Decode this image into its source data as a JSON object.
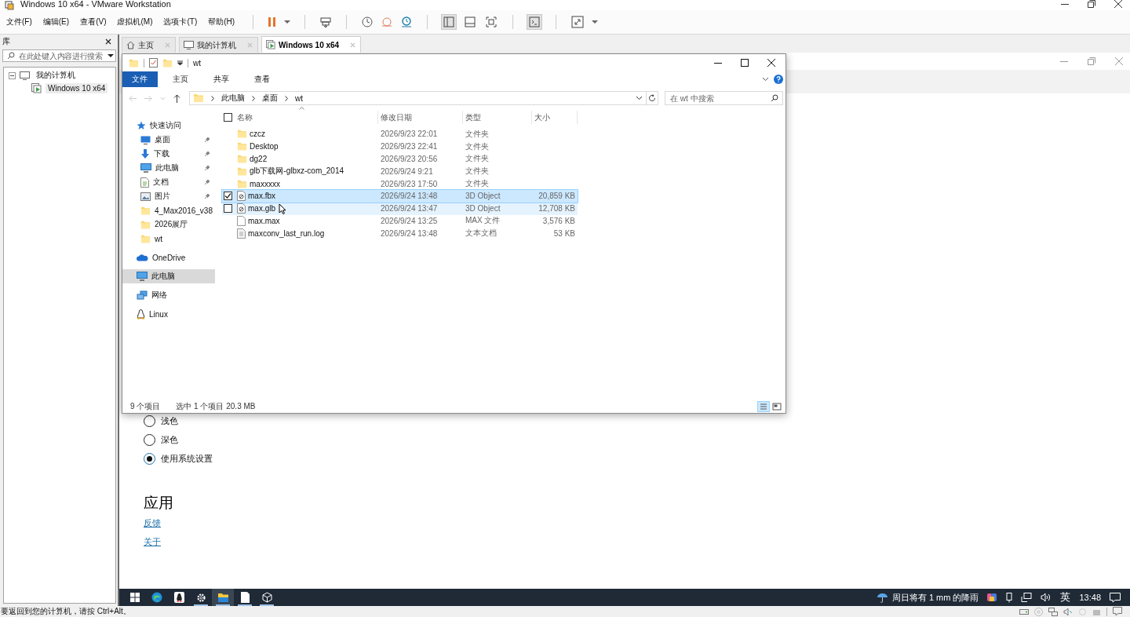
{
  "window": {
    "title": "Windows 10 x64 - VMware Workstation"
  },
  "menu": [
    "文件(F)",
    "编辑(E)",
    "查看(V)",
    "虚拟机(M)",
    "选项卡(T)",
    "帮助(H)"
  ],
  "library": {
    "title": "库",
    "search_placeholder": "在此处键入内容进行搜索",
    "tree": [
      {
        "label": "我的计算机",
        "expanded": true,
        "selected": false,
        "children": [
          {
            "label": "Windows 10 x64",
            "selected": true
          }
        ]
      }
    ]
  },
  "tabs": [
    {
      "label": "主页",
      "kind": "home",
      "selected": false
    },
    {
      "label": "我的计算机",
      "kind": "computer",
      "selected": false
    },
    {
      "label": "Windows 10 x64",
      "kind": "vm",
      "selected": true
    }
  ],
  "settings": {
    "radios": [
      {
        "label": "浅色",
        "selected": false
      },
      {
        "label": "深色",
        "selected": false
      },
      {
        "label": "使用系统设置",
        "selected": true
      }
    ],
    "heading": "应用",
    "links": [
      "反馈",
      "关于"
    ]
  },
  "explorer": {
    "title": "wt",
    "ribbon_tabs": [
      {
        "label": "文件",
        "selected": true
      },
      {
        "label": "主页",
        "selected": false
      },
      {
        "label": "共享",
        "selected": false
      },
      {
        "label": "查看",
        "selected": false
      }
    ],
    "breadcrumb": [
      "此电脑",
      "桌面",
      "wt"
    ],
    "search_placeholder": "在 wt 中搜索",
    "nav": [
      {
        "label": "快速访问",
        "kind": "star",
        "selected": false,
        "children": [
          {
            "label": "桌面",
            "kind": "desktop",
            "pinned": true,
            "selected": false
          },
          {
            "label": "下载",
            "kind": "download",
            "pinned": true,
            "selected": false
          },
          {
            "label": "此电脑",
            "kind": "pc",
            "pinned": true,
            "selected": false
          },
          {
            "label": "文档",
            "kind": "document",
            "pinned": true,
            "selected": false
          },
          {
            "label": "图片",
            "kind": "pictures",
            "pinned": true,
            "selected": false
          },
          {
            "label": "4_Max2016_v38",
            "kind": "folder",
            "pinned": false,
            "selected": false
          },
          {
            "label": "2026展厅",
            "kind": "folder",
            "pinned": false,
            "selected": false
          },
          {
            "label": "wt",
            "kind": "folder",
            "pinned": false,
            "selected": false
          }
        ]
      },
      {
        "label": "OneDrive",
        "kind": "cloud",
        "selected": false
      },
      {
        "label": "此电脑",
        "kind": "pc",
        "selected": true
      },
      {
        "label": "网络",
        "kind": "network",
        "selected": false
      },
      {
        "label": "Linux",
        "kind": "linux",
        "selected": false
      }
    ],
    "columns": [
      "名称",
      "修改日期",
      "类型",
      "大小"
    ],
    "select_all": false,
    "files": [
      {
        "name": "czcz",
        "date": "2026/9/23 22:01",
        "type": "文件夹",
        "kind": "folder",
        "selected": false,
        "hovered": false
      },
      {
        "name": "Desktop",
        "date": "2026/9/23 22:41",
        "type": "文件夹",
        "kind": "folder",
        "selected": false,
        "hovered": false
      },
      {
        "name": "dg22",
        "date": "2026/9/23 20:56",
        "type": "文件夹",
        "kind": "folder",
        "selected": false,
        "hovered": false
      },
      {
        "name": "glb下载网-glbxz-com_2014",
        "date": "2026/9/24 9:21",
        "type": "文件夹",
        "kind": "folder",
        "selected": false,
        "hovered": false
      },
      {
        "name": "maxxxxx",
        "date": "2026/9/23 17:50",
        "type": "文件夹",
        "kind": "folder",
        "selected": false,
        "hovered": false
      },
      {
        "name": "max.fbx",
        "date": "2026/9/24 13:48",
        "type": "3D Object",
        "size": "20,859 KB",
        "kind": "object",
        "selected": true,
        "hovered": false
      },
      {
        "name": "max.glb",
        "date": "2026/9/24 13:47",
        "type": "3D Object",
        "size": "12,708 KB",
        "kind": "object",
        "selected": false,
        "hovered": true
      },
      {
        "name": "max.max",
        "date": "2026/9/24 13:25",
        "type": "MAX 文件",
        "size": "3,576 KB",
        "kind": "blank",
        "selected": false,
        "hovered": false
      },
      {
        "name": "maxconv_last_run.log",
        "date": "2026/9/24 13:48",
        "type": "文本文档",
        "size": "53 KB",
        "kind": "text",
        "selected": false,
        "hovered": false
      }
    ],
    "status": {
      "count": "9 个项目",
      "selection": "选中 1 个项目  20.3 MB"
    }
  },
  "taskbar": {
    "apps": [
      {
        "kind": "edge",
        "running": false,
        "active": false
      },
      {
        "kind": "penguin",
        "running": false,
        "active": false
      },
      {
        "kind": "gear",
        "running": true,
        "active": false
      },
      {
        "kind": "folder",
        "running": true,
        "active": true
      },
      {
        "kind": "page",
        "running": true,
        "active": false
      },
      {
        "kind": "cube",
        "running": true,
        "active": false
      }
    ],
    "weather": "周日将有 1 mm 的降雨",
    "ime": "英",
    "time": "13:48"
  },
  "status_bar": {
    "hint": "要返回到您的计算机，请按 Ctrl+Alt。"
  }
}
